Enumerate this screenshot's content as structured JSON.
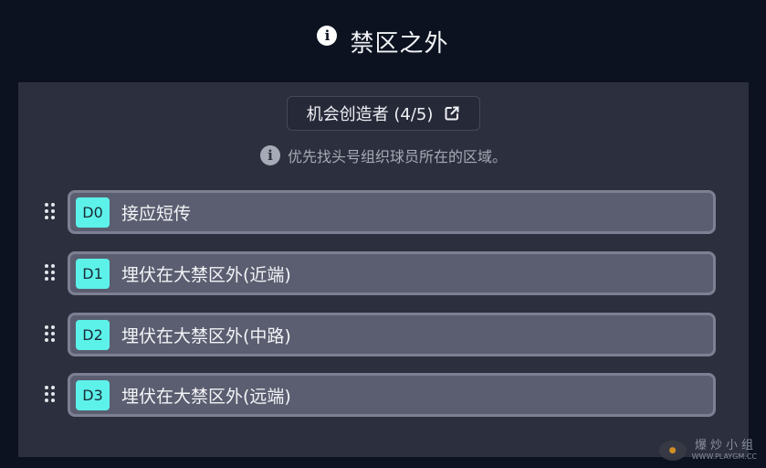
{
  "header": {
    "info_icon": "i",
    "title": "禁区之外"
  },
  "panel": {
    "button": {
      "label": "机会创造者 (4/5)",
      "icon": "external-link-icon"
    },
    "hint": {
      "icon": "i",
      "text": "优先找头号组织球员所在的区域。"
    },
    "items": [
      {
        "badge": "D0",
        "label": "接应短传"
      },
      {
        "badge": "D1",
        "label": "埋伏在大禁区外(近端)"
      },
      {
        "badge": "D2",
        "label": "埋伏在大禁区外(中路)"
      },
      {
        "badge": "D3",
        "label": "埋伏在大禁区外(远端)"
      }
    ]
  },
  "watermark": {
    "cn": "爆炒小组",
    "url": "WWW.PLAYGM.CC"
  },
  "colors": {
    "background": "#0c1220",
    "panel": "#2c2f3d",
    "card": "#5b5e70",
    "card_border": "#7c8092",
    "badge": "#5cf2ea",
    "hint_text": "#a6aab6"
  }
}
